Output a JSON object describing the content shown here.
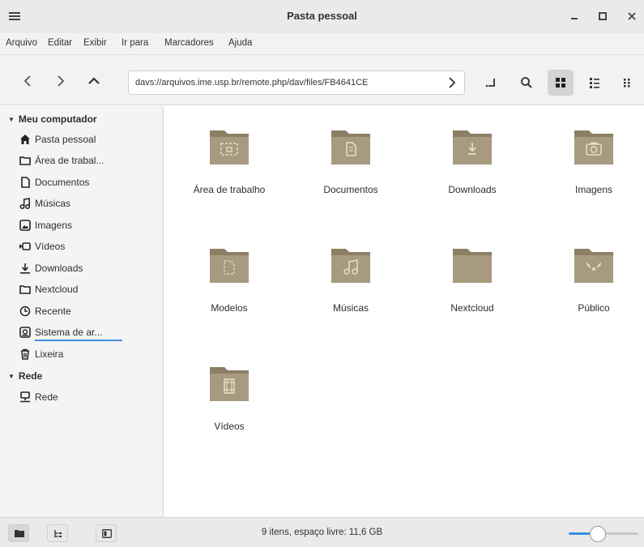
{
  "window": {
    "title": "Pasta pessoal",
    "minimize_label": "–",
    "maximize_label": "▫",
    "close_label": "×"
  },
  "menubar": [
    "Arquivo",
    "Editar",
    "Exibir",
    "Ir para",
    "Marcadores",
    "Ajuda"
  ],
  "location": {
    "path": "davs://arquivos.ime.usp.br/remote.php/dav/files/FB4641CE"
  },
  "sidebar": {
    "computer_header": "Meu computador",
    "computer_items": [
      {
        "label": "Pasta pessoal",
        "icon": "home-icon"
      },
      {
        "label": "Área de trabal...",
        "icon": "folder-icon"
      },
      {
        "label": "Documentos",
        "icon": "document-icon"
      },
      {
        "label": "Músicas",
        "icon": "music-icon"
      },
      {
        "label": "Imagens",
        "icon": "image-icon"
      },
      {
        "label": "Vídeos",
        "icon": "video-icon"
      },
      {
        "label": "Downloads",
        "icon": "download-icon"
      },
      {
        "label": "Nextcloud",
        "icon": "folder-icon"
      },
      {
        "label": "Recente",
        "icon": "clock-icon"
      },
      {
        "label": "Sistema de ar...",
        "icon": "drive-icon",
        "usage_fraction": 0.95
      },
      {
        "label": "Lixeira",
        "icon": "trash-icon"
      }
    ],
    "network_header": "Rede",
    "network_items": [
      {
        "label": "Rede",
        "icon": "network-icon"
      }
    ]
  },
  "files": [
    {
      "name": "Área de trabalho",
      "emblem": "desktop"
    },
    {
      "name": "Documentos",
      "emblem": "document"
    },
    {
      "name": "Downloads",
      "emblem": "download"
    },
    {
      "name": "Imagens",
      "emblem": "camera"
    },
    {
      "name": "Modelos",
      "emblem": "template"
    },
    {
      "name": "Músicas",
      "emblem": "music"
    },
    {
      "name": "Nextcloud",
      "emblem": "none"
    },
    {
      "name": "Público",
      "emblem": "share"
    },
    {
      "name": "Vídeos",
      "emblem": "video"
    }
  ],
  "status": {
    "text": "9 itens, espaço livre: 11,6 GB",
    "zoom_fraction": 0.4
  },
  "colors": {
    "folder": "#a89a7e",
    "folder_tab": "#8c7f66",
    "accent": "#3d8ee0"
  }
}
